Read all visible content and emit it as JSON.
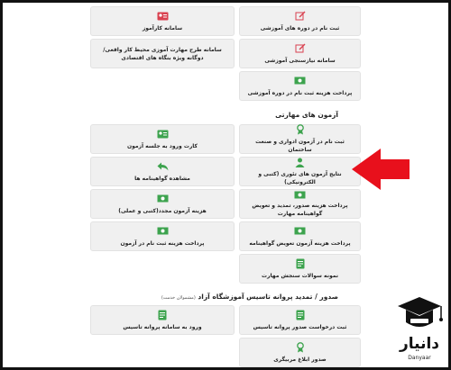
{
  "cards": {
    "c1": "ثبت نام در دوره های آموزشی",
    "c2": "سامانه کارآموز",
    "c3": "سامانه نیازسنجی آموزشی",
    "c4": "سامانه طرح مهارت آموزی محیط کار واقعی/دوگانه ویژه بنگاه های اقتصادی",
    "c5": "پرداخت هزینه ثبت نام در دوره آموزشی",
    "c6": "ثبت نام در آزمون ادواری و صنعت ساختمان",
    "c7": "کارت ورود به جلسه آزمون",
    "c8": "نتایج آزمون های تئوری (کتبی و الکترونیکی)",
    "c9": "مشاهده گواهینامه ها",
    "c10": "پرداخت هزینه صدور، تمدید و تعویض گواهینامه مهارت",
    "c11": "هزینه آزمون مجدد(کتبی و عملی)",
    "c12": "پرداخت هزینه آزمون تعویض گواهینامه",
    "c13": "پرداخت هزینه ثبت نام در آزمون",
    "c14": "نمونه سوالات سنجش مهارت",
    "c15": "ثبت درخواست صدور پروانه تاسیس",
    "c16": "ورود به سامانه پروانه تاسیس",
    "c17": "صدور ابلاغ مربیگری"
  },
  "sections": {
    "skills": "آزمون های مهارتی",
    "license": "صدور / تمدید پروانه تاسیس آموزشگاه آزاد",
    "license_small": "(مشمولان خدمت)"
  },
  "logo": {
    "name": "دانیار",
    "sub": "Danyaar"
  },
  "colors": {
    "icon_red": "#d9414f",
    "icon_green": "#3da34e",
    "arrow_red": "#e8101c"
  }
}
